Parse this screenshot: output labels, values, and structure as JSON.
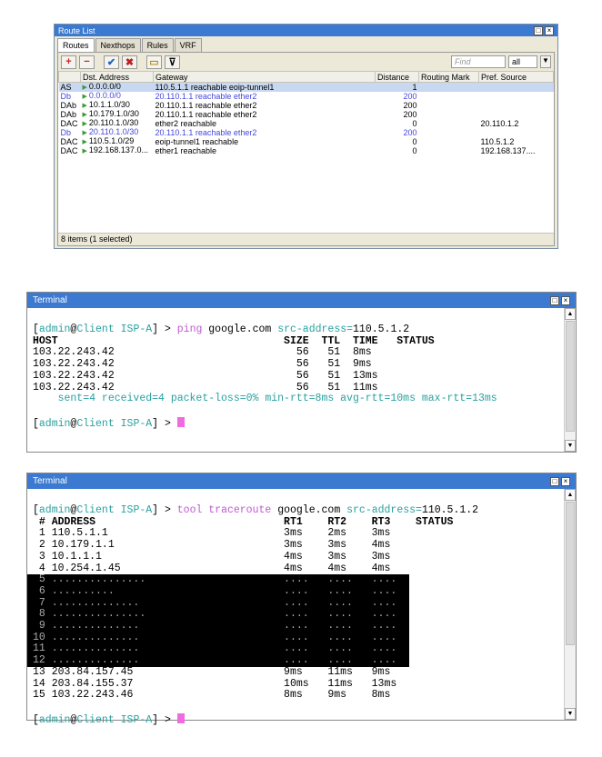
{
  "route_list": {
    "title": "Route List",
    "tabs": [
      "Routes",
      "Nexthops",
      "Rules",
      "VRF"
    ],
    "find_placeholder": "Find",
    "filter_value": "all",
    "columns": [
      "",
      "Dst. Address",
      "Gateway",
      "Distance",
      "Routing Mark",
      "Pref. Source"
    ],
    "rows": [
      {
        "flags": "AS",
        "dst": "0.0.0.0/0",
        "gateway": "110.5.1.1 reachable eoip-tunnel1",
        "distance": "1",
        "mark": "",
        "pref": "",
        "selected": true,
        "dynamic": false
      },
      {
        "flags": "Db",
        "dst": "0.0.0.0/0",
        "gateway": "20.110.1.1 reachable ether2",
        "distance": "200",
        "mark": "",
        "pref": "",
        "selected": false,
        "dynamic": true
      },
      {
        "flags": "DAb",
        "dst": "10.1.1.0/30",
        "gateway": "20.110.1.1 reachable ether2",
        "distance": "200",
        "mark": "",
        "pref": "",
        "selected": false,
        "dynamic": false
      },
      {
        "flags": "DAb",
        "dst": "10.179.1.0/30",
        "gateway": "20.110.1.1 reachable ether2",
        "distance": "200",
        "mark": "",
        "pref": "",
        "selected": false,
        "dynamic": false
      },
      {
        "flags": "DAC",
        "dst": "20.110.1.0/30",
        "gateway": "ether2 reachable",
        "distance": "0",
        "mark": "",
        "pref": "20.110.1.2",
        "selected": false,
        "dynamic": false
      },
      {
        "flags": "Db",
        "dst": "20.110.1.0/30",
        "gateway": "20.110.1.1 reachable ether2",
        "distance": "200",
        "mark": "",
        "pref": "",
        "selected": false,
        "dynamic": true
      },
      {
        "flags": "DAC",
        "dst": "110.5.1.0/29",
        "gateway": "eoip-tunnel1 reachable",
        "distance": "0",
        "mark": "",
        "pref": "110.5.1.2",
        "selected": false,
        "dynamic": false
      },
      {
        "flags": "DAC",
        "dst": "192.168.137.0...",
        "gateway": "ether1 reachable",
        "distance": "0",
        "mark": "",
        "pref": "192.168.137....",
        "selected": false,
        "dynamic": false
      }
    ],
    "status": "8 items (1 selected)"
  },
  "terminal1": {
    "title": "Terminal",
    "prompt_user": "admin",
    "prompt_host": "Client ISP-A",
    "command": "ping",
    "arg": "google.com",
    "param": "src-address",
    "param_value": "110.5.1.2",
    "header": "HOST                                    SIZE  TTL  TIME   STATUS",
    "lines": [
      "103.22.243.42                             56   51  8ms",
      "103.22.243.42                             56   51  9ms",
      "103.22.243.42                             56   51  13ms",
      "103.22.243.42                             56   51  11ms"
    ],
    "summary": "    sent=4 received=4 packet-loss=0% min-rtt=8ms avg-rtt=10ms max-rtt=13ms"
  },
  "terminal2": {
    "title": "Terminal",
    "command": "tool traceroute",
    "arg": "google.com",
    "param": "src-address",
    "param_value": "110.5.1.2",
    "header": " # ADDRESS                              RT1    RT2    RT3    STATUS",
    "lines_top": [
      " 1 110.5.1.1                            3ms    2ms    3ms",
      " 2 10.179.1.1                           3ms    3ms    4ms",
      " 3 10.1.1.1                             4ms    3ms    3ms",
      " 4 10.254.1.45                          4ms    4ms    4ms"
    ],
    "lines_redacted": [
      " 5 ...............                      ....   ....   ....",
      " 6 ..........                           ....   ....   ....",
      " 7 ..............                       ....   ....   ....",
      " 8 ...............                      ....   ....   ....",
      " 9 ..............                       ....   ....   ....",
      "10 ..............                       ....   ....   ....",
      "11 ..............                       ....   ....   ....",
      "12 ..............                       ....   ....   ...."
    ],
    "lines_bottom": [
      "13 203.84.157.45                        9ms    11ms   9ms",
      "14 203.84.155.37                        10ms   11ms   13ms",
      "15 103.22.243.46                        8ms    9ms    8ms"
    ]
  }
}
